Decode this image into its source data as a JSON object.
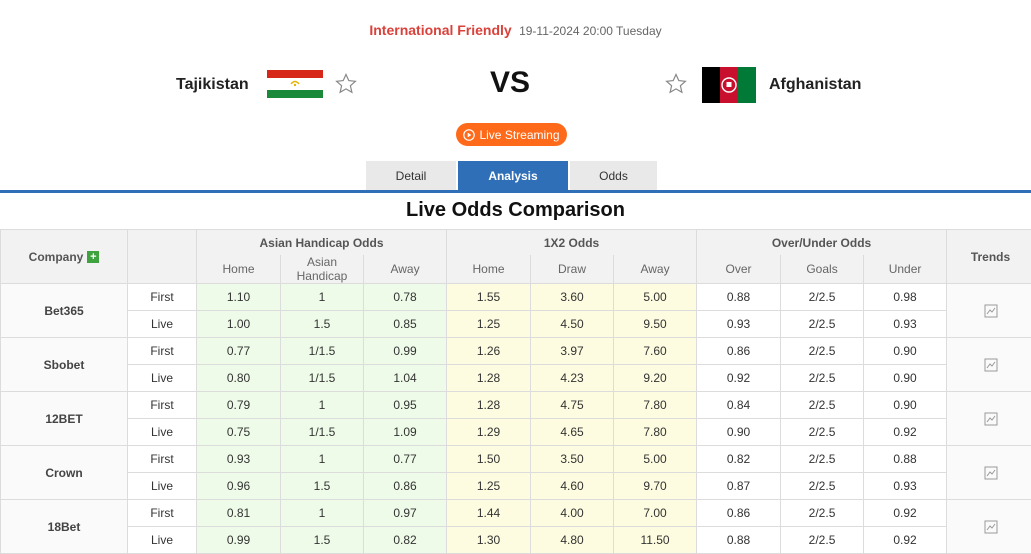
{
  "match": {
    "league": "International Friendly",
    "datetime": "19-11-2024 20:00 Tuesday",
    "home_team": "Tajikistan",
    "away_team": "Afghanistan",
    "vs": "VS",
    "live_label": "Live Streaming"
  },
  "tabs": [
    {
      "label": "Detail"
    },
    {
      "label": "Analysis",
      "active": true
    },
    {
      "label": "Odds"
    }
  ],
  "section_title": "Live Odds Comparison",
  "table": {
    "company_header": "Company",
    "trends_header": "Trends",
    "groups": [
      "Asian Handicap Odds",
      "1X2 Odds",
      "Over/Under Odds"
    ],
    "sub_headers": [
      "Home",
      "Asian Handicap",
      "Away",
      "Home",
      "Draw",
      "Away",
      "Over",
      "Goals",
      "Under"
    ],
    "rows": [
      {
        "company": "Bet365",
        "first": [
          "1.10",
          "1",
          "0.78",
          "1.55",
          "3.60",
          "5.00",
          "0.88",
          "2/2.5",
          "0.98"
        ],
        "live": [
          "1.00",
          "1.5",
          "0.85",
          "1.25",
          "4.50",
          "9.50",
          "0.93",
          "2/2.5",
          "0.93"
        ]
      },
      {
        "company": "Sbobet",
        "first": [
          "0.77",
          "1/1.5",
          "0.99",
          "1.26",
          "3.97",
          "7.60",
          "0.86",
          "2/2.5",
          "0.90"
        ],
        "live": [
          "0.80",
          "1/1.5",
          "1.04",
          "1.28",
          "4.23",
          "9.20",
          "0.92",
          "2/2.5",
          "0.90"
        ]
      },
      {
        "company": "12BET",
        "first": [
          "0.79",
          "1",
          "0.95",
          "1.28",
          "4.75",
          "7.80",
          "0.84",
          "2/2.5",
          "0.90"
        ],
        "live": [
          "0.75",
          "1/1.5",
          "1.09",
          "1.29",
          "4.65",
          "7.80",
          "0.90",
          "2/2.5",
          "0.92"
        ]
      },
      {
        "company": "Crown",
        "first": [
          "0.93",
          "1",
          "0.77",
          "1.50",
          "3.50",
          "5.00",
          "0.82",
          "2/2.5",
          "0.88"
        ],
        "live": [
          "0.96",
          "1.5",
          "0.86",
          "1.25",
          "4.60",
          "9.70",
          "0.87",
          "2/2.5",
          "0.93"
        ]
      },
      {
        "company": "18Bet",
        "first": [
          "0.81",
          "1",
          "0.97",
          "1.44",
          "4.00",
          "7.00",
          "0.86",
          "2/2.5",
          "0.92"
        ],
        "live": [
          "0.99",
          "1.5",
          "0.82",
          "1.30",
          "4.80",
          "11.50",
          "0.88",
          "2/2.5",
          "0.92"
        ]
      }
    ],
    "row_labels": {
      "first": "First",
      "live": "Live"
    }
  },
  "colors": {
    "accent": "#2e6fb7",
    "league": "#d9413a",
    "live_button": "#ff6a1a",
    "asian_bg": "#effbe9",
    "x12_bg": "#fdfce0"
  },
  "icons": {
    "favorite": "star-outline-icon",
    "play": "play-circle-icon",
    "add": "plus-icon",
    "trend": "chart-icon"
  }
}
